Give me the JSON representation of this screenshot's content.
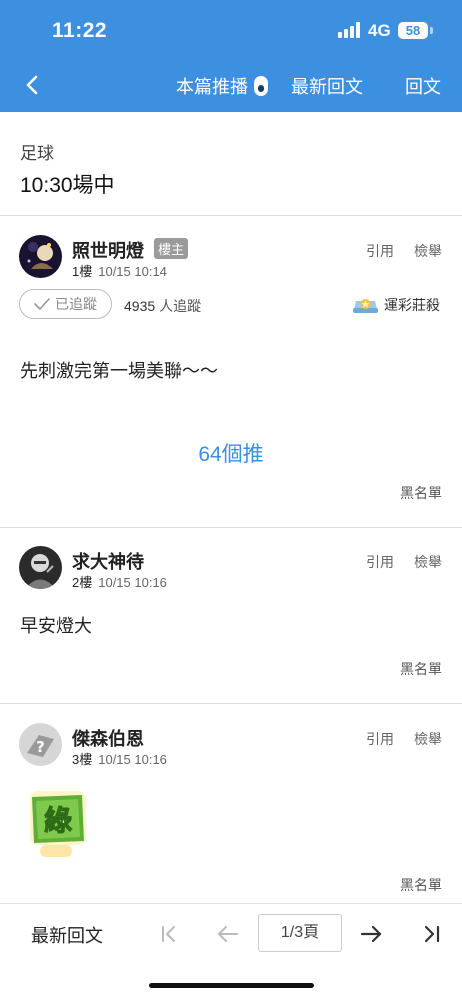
{
  "status_bar": {
    "time": "11:22",
    "network": "4G",
    "battery": "58"
  },
  "nav": {
    "push_label": "本篇推播",
    "latest_label": "最新回文",
    "reply_label": "回文"
  },
  "board": {
    "name": "足球",
    "title": "10:30場中"
  },
  "posts": [
    {
      "author": "照世明燈",
      "badge": "樓主",
      "floor": "1樓",
      "time": "10/15 10:14",
      "quote": "引用",
      "report": "檢舉",
      "follow_label": "已追蹤",
      "follow_count": "4935",
      "follow_unit": "人追蹤",
      "tag": "運彩莊殺",
      "body": "先刺激完第一場美聯～～",
      "push_count": "64個推",
      "blacklist": "黑名單"
    },
    {
      "author": "求大神待",
      "floor": "2樓",
      "time": "10/15 10:16",
      "quote": "引用",
      "report": "檢舉",
      "body": "早安燈大",
      "blacklist": "黑名單"
    },
    {
      "author": "傑森伯恩",
      "floor": "3樓",
      "time": "10/15 10:16",
      "quote": "引用",
      "report": "檢舉",
      "sticker_text": "綠",
      "blacklist": "黑名單"
    }
  ],
  "bottom": {
    "latest_label": "最新回文",
    "page": "1/3頁"
  },
  "colors": {
    "primary": "#3d8fe0",
    "badge": "#9a9a9a"
  }
}
